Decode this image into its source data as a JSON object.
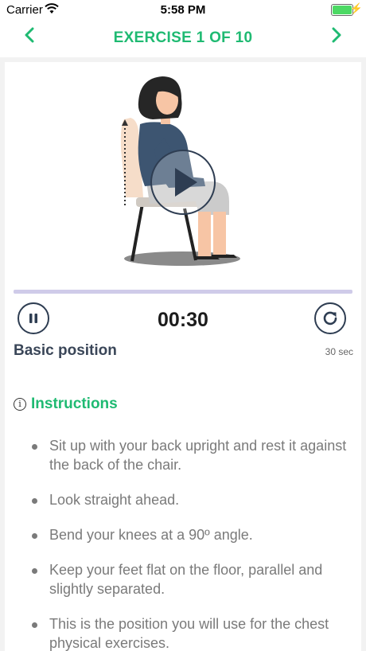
{
  "status_bar": {
    "carrier": "Carrier",
    "time": "5:58 PM",
    "battery_level": 1.0
  },
  "nav": {
    "title": "EXERCISE 1 OF 10",
    "back_icon": "chevron-left-icon",
    "next_icon": "chevron-right-icon"
  },
  "player": {
    "progress": 0.0,
    "timer": "00:30",
    "position_title": "Basic position",
    "duration": "30 sec",
    "pause_icon": "pause-icon",
    "restart_icon": "restart-icon",
    "play_icon": "play-icon"
  },
  "instructions": {
    "title": "Instructions",
    "items": [
      "Sit up with your back upright and rest it against the back of the chair.",
      "Look straight ahead.",
      "Bend your knees at a 90º angle.",
      "Keep your feet flat on the floor, parallel and slightly separated.",
      "This is the position you will use for the chest physical exercises."
    ]
  },
  "colors": {
    "accent": "#1fba72",
    "progress_track": "#cfcbe9",
    "dark": "#2e3d52"
  }
}
